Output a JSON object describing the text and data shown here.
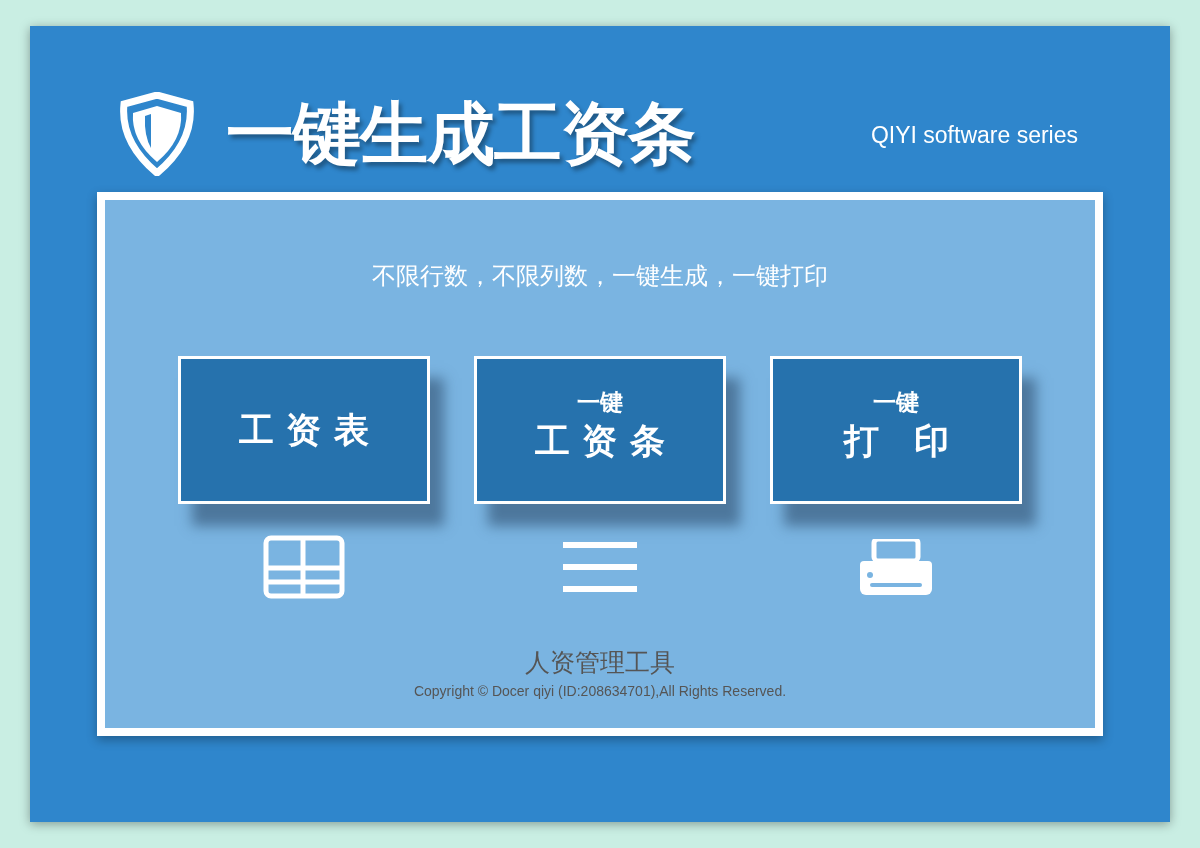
{
  "header": {
    "title": "一键生成工资条",
    "series": "QIYI software series"
  },
  "panel": {
    "tagline": "不限行数，不限列数，一键生成，一键打印",
    "actions": [
      {
        "kind": "table",
        "label": "工 资 表"
      },
      {
        "kind": "lines",
        "prefix": "一键",
        "label": "工 资 条"
      },
      {
        "kind": "printer",
        "prefix": "一键",
        "label": "打　印"
      }
    ],
    "footer_title": "人资管理工具",
    "copyright": "Copyright © Docer qiyi (ID:208634701),All Rights Reserved."
  }
}
